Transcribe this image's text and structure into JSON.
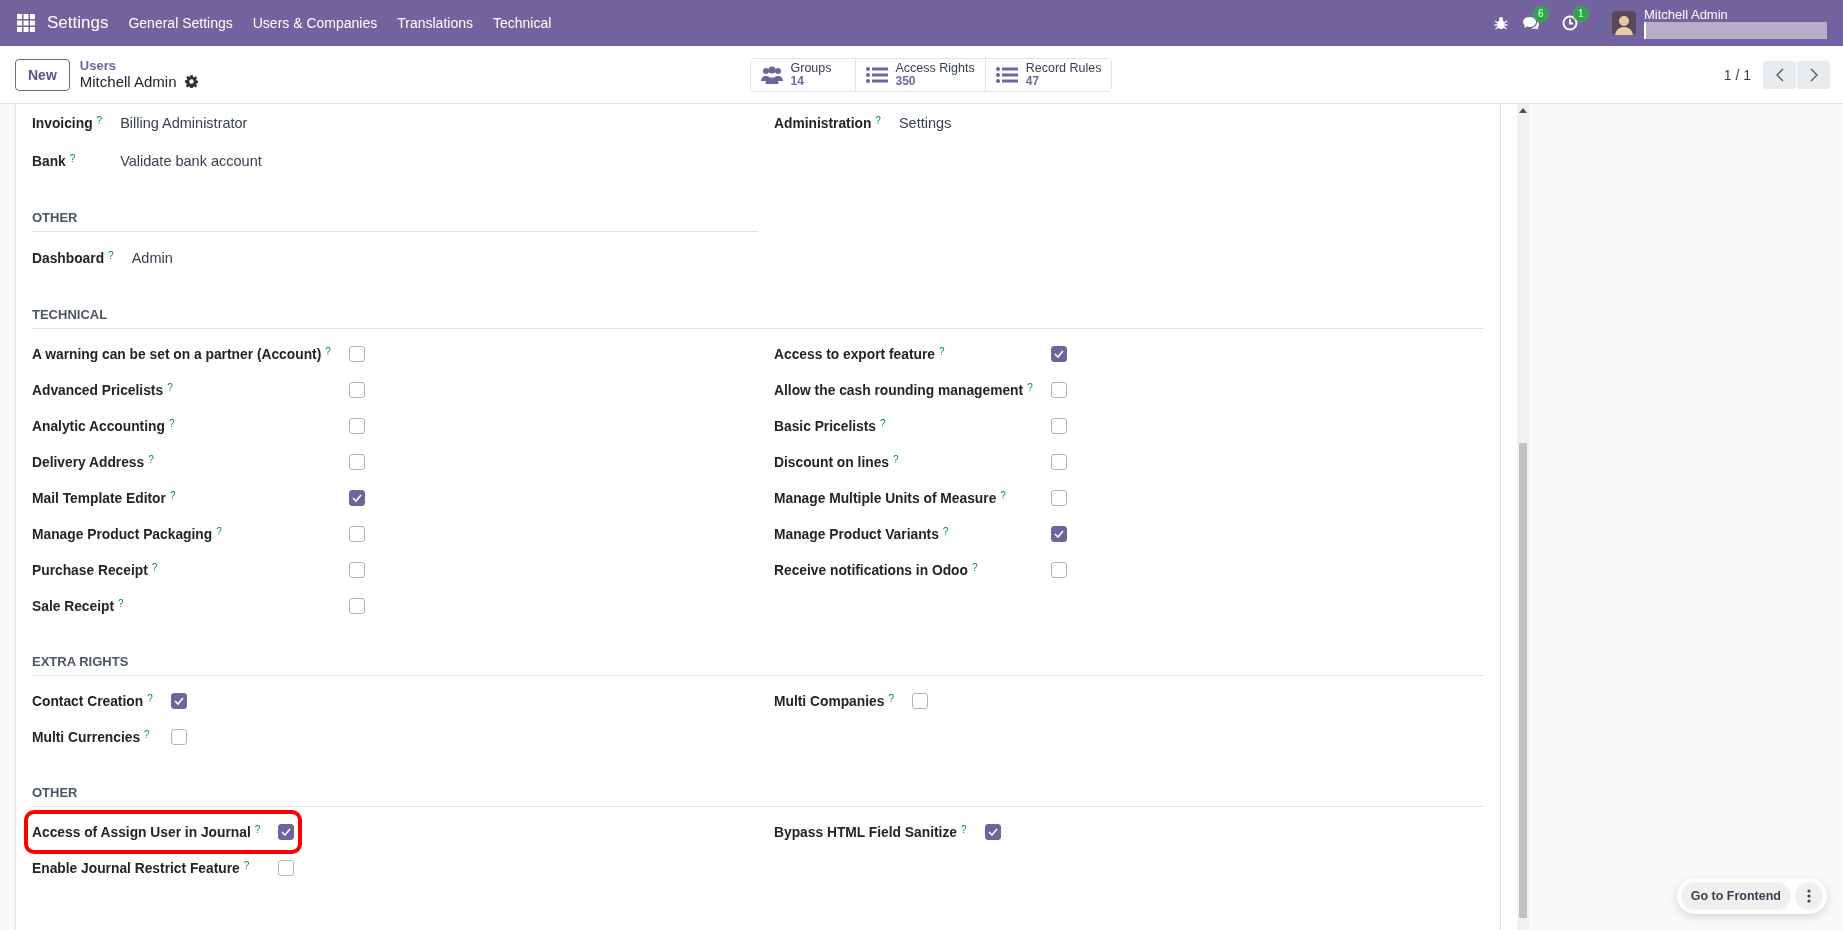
{
  "navbar": {
    "app_title": "Settings",
    "menu": [
      "General Settings",
      "Users & Companies",
      "Translations",
      "Technical"
    ],
    "messages_badge": "6",
    "activities_badge": "1",
    "user_name": "Mitchell Admin"
  },
  "control_panel": {
    "new_button": "New",
    "breadcrumb_parent": "Users",
    "record_name": "Mitchell Admin",
    "pager": "1 / 1",
    "smart_buttons": [
      {
        "kind": "users",
        "label": "Groups",
        "count": "14"
      },
      {
        "kind": "list",
        "label": "Access Rights",
        "count": "350"
      },
      {
        "kind": "list",
        "label": "Record Rules",
        "count": "47"
      }
    ]
  },
  "sections": [
    {
      "left": [
        {
          "kind": "value",
          "label": "Invoicing",
          "help": "?",
          "value": "Billing Administrator"
        },
        {
          "kind": "value",
          "label": "Bank",
          "help": "?",
          "value": "Validate bank account"
        }
      ],
      "right": [
        {
          "kind": "value",
          "label": "Administration",
          "help": "?",
          "value": "Settings"
        }
      ]
    },
    {
      "title": "OTHER",
      "narrow": true,
      "left": [
        {
          "kind": "value",
          "label": "Dashboard",
          "help": "?",
          "value": "Admin"
        }
      ]
    },
    {
      "title": "TECHNICAL",
      "narrow": false,
      "left": [
        {
          "kind": "checkbox",
          "label": "A warning can be set on a partner (Account)",
          "help": "?",
          "checked": false
        },
        {
          "kind": "checkbox",
          "label": "Advanced Pricelists",
          "help": "?",
          "checked": false
        },
        {
          "kind": "checkbox",
          "label": "Analytic Accounting",
          "help": "?",
          "checked": false
        },
        {
          "kind": "checkbox",
          "label": "Delivery Address",
          "help": "?",
          "checked": false
        },
        {
          "kind": "checkbox",
          "label": "Mail Template Editor",
          "help": "?",
          "checked": true
        },
        {
          "kind": "checkbox",
          "label": "Manage Product Packaging",
          "help": "?",
          "checked": false
        },
        {
          "kind": "checkbox",
          "label": "Purchase Receipt",
          "help": "?",
          "checked": false
        },
        {
          "kind": "checkbox",
          "label": "Sale Receipt",
          "help": "?",
          "checked": false
        }
      ],
      "right": [
        {
          "kind": "checkbox",
          "label": "Access to export feature",
          "help": "?",
          "checked": true
        },
        {
          "kind": "checkbox",
          "label": "Allow the cash rounding management",
          "help": "?",
          "checked": false
        },
        {
          "kind": "checkbox",
          "label": "Basic Pricelists",
          "help": "?",
          "checked": false
        },
        {
          "kind": "checkbox",
          "label": "Discount on lines",
          "help": "?",
          "checked": false
        },
        {
          "kind": "checkbox",
          "label": "Manage Multiple Units of Measure",
          "help": "?",
          "checked": false
        },
        {
          "kind": "checkbox",
          "label": "Manage Product Variants",
          "help": "?",
          "checked": true
        },
        {
          "kind": "checkbox",
          "label": "Receive notifications in Odoo",
          "help": "?",
          "checked": false
        }
      ]
    },
    {
      "title": "EXTRA RIGHTS",
      "narrow": false,
      "left": [
        {
          "kind": "checkbox",
          "label": "Contact Creation",
          "help": "?",
          "checked": true
        },
        {
          "kind": "checkbox",
          "label": "Multi Currencies",
          "help": "?",
          "checked": false
        }
      ],
      "right": [
        {
          "kind": "checkbox",
          "label": "Multi Companies",
          "help": "?",
          "checked": false
        }
      ]
    },
    {
      "title": "OTHER",
      "narrow": false,
      "left": [
        {
          "kind": "checkbox",
          "label": "Access of Assign User in Journal",
          "help": "?",
          "checked": true,
          "highlighted": true
        },
        {
          "kind": "checkbox",
          "label": "Enable Journal Restrict Feature",
          "help": "?",
          "checked": false,
          "highlighted": false
        }
      ],
      "right": [
        {
          "kind": "checkbox",
          "label": "Bypass HTML Field Sanitize",
          "help": "?",
          "checked": true,
          "highlighted": false
        }
      ]
    }
  ],
  "frontend_button": "Go to Frontend"
}
